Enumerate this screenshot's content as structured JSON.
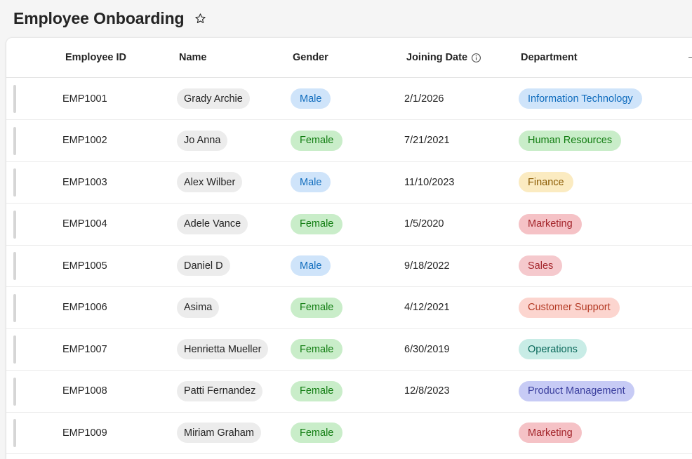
{
  "page": {
    "title": "Employee Onboarding"
  },
  "icons": {
    "favorite": "star-outline-icon",
    "column_info": "info-circle-icon"
  },
  "columns": {
    "employee_id": "Employee ID",
    "name": "Name",
    "gender": "Gender",
    "joining_date": "Joining Date",
    "department": "Department"
  },
  "department_colors": {
    "Information Technology": {
      "bg": "#cfe4fa",
      "fg": "#0f6cbd"
    },
    "Human Resources": {
      "bg": "#c9edc9",
      "fg": "#107c10"
    },
    "Finance": {
      "bg": "#fbebc1",
      "fg": "#8a5a00"
    },
    "Marketing": {
      "bg": "#f5c2c6",
      "fg": "#a4262c"
    },
    "Sales": {
      "bg": "#f5c9cd",
      "fg": "#a4262c"
    },
    "Customer Support": {
      "bg": "#fcd5cf",
      "fg": "#b43a24"
    },
    "Operations": {
      "bg": "#c8ece6",
      "fg": "#0b6a5c"
    },
    "Product Management": {
      "bg": "#c7cbf5",
      "fg": "#3b3f9e"
    }
  },
  "rows": [
    {
      "employee_id": "EMP1001",
      "name": "Grady Archie",
      "gender": "Male",
      "joining_date": "2/1/2026",
      "department": "Information Technology"
    },
    {
      "employee_id": "EMP1002",
      "name": "Jo Anna",
      "gender": "Female",
      "joining_date": "7/21/2021",
      "department": "Human Resources"
    },
    {
      "employee_id": "EMP1003",
      "name": "Alex Wilber",
      "gender": "Male",
      "joining_date": "11/10/2023",
      "department": "Finance"
    },
    {
      "employee_id": "EMP1004",
      "name": "Adele Vance",
      "gender": "Female",
      "joining_date": "1/5/2020",
      "department": "Marketing"
    },
    {
      "employee_id": "EMP1005",
      "name": "Daniel D",
      "gender": "Male",
      "joining_date": "9/18/2022",
      "department": "Sales"
    },
    {
      "employee_id": "EMP1006",
      "name": "Asima",
      "gender": "Female",
      "joining_date": "4/12/2021",
      "department": "Customer Support"
    },
    {
      "employee_id": "EMP1007",
      "name": "Henrietta Mueller",
      "gender": "Female",
      "joining_date": "6/30/2019",
      "department": "Operations"
    },
    {
      "employee_id": "EMP1008",
      "name": "Patti Fernandez",
      "gender": "Female",
      "joining_date": "12/8/2023",
      "department": "Product Management"
    },
    {
      "employee_id": "EMP1009",
      "name": "Miriam Graham",
      "gender": "Female",
      "joining_date": "",
      "department": "Marketing"
    }
  ]
}
